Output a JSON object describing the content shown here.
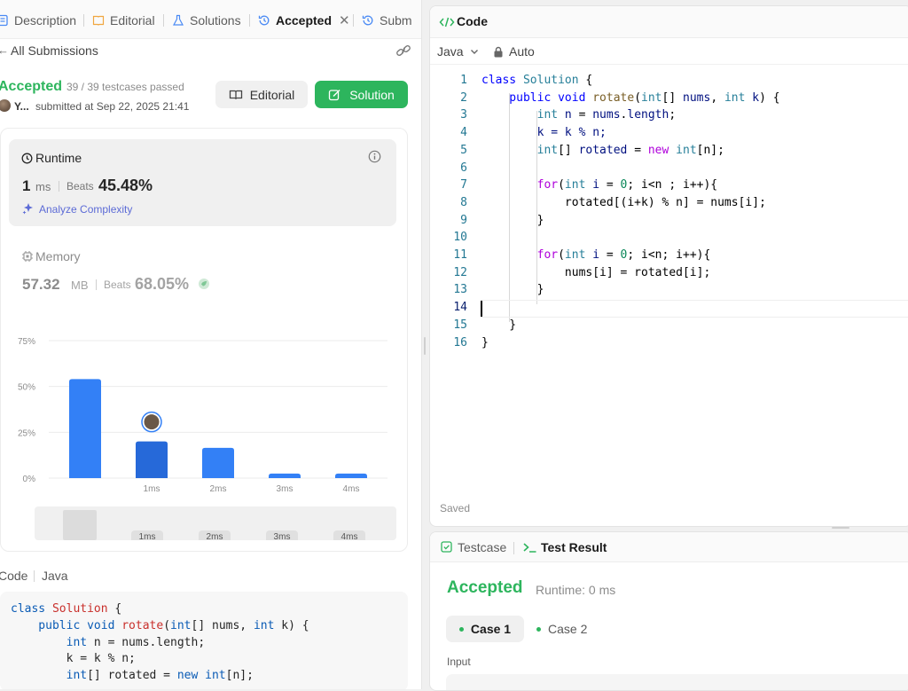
{
  "left_tabs": [
    {
      "label": "Description",
      "icon": "description-icon"
    },
    {
      "label": "Editorial",
      "icon": "book-icon"
    },
    {
      "label": "Solutions",
      "icon": "flask-icon"
    },
    {
      "label": "Accepted",
      "icon": "history-icon",
      "active": true
    },
    {
      "label": "Subm",
      "icon": "history-icon"
    }
  ],
  "submission": {
    "back_label": "All Submissions",
    "status": "Accepted",
    "testcases": "39 / 39 testcases passed",
    "user": "Y...",
    "submitted_at": "submitted at Sep 22, 2025 21:41",
    "editorial_button": "Editorial",
    "solution_button": "Solution"
  },
  "runtime": {
    "title": "Runtime",
    "value": "1",
    "unit": "ms",
    "beats_label": "Beats",
    "beats": "45.48%",
    "analyze_label": "Analyze Complexity"
  },
  "memory": {
    "title": "Memory",
    "value": "57.32",
    "unit": "MB",
    "beats_label": "Beats",
    "beats": "68.05%"
  },
  "chart_data": {
    "type": "bar",
    "categories": [
      "",
      "1ms",
      "2ms",
      "3ms",
      "4ms"
    ],
    "values": [
      54,
      20,
      16.5,
      2.5,
      2.5
    ],
    "highlight_index": 1,
    "yticks": [
      "0%",
      "25%",
      "50%",
      "75%"
    ],
    "ylim": [
      0,
      75
    ],
    "grid": true,
    "navigator_labels": [
      "1ms",
      "2ms",
      "3ms",
      "4ms"
    ],
    "colors": {
      "bar": "#3380f6",
      "highlight": "#2669d9",
      "grid": "#ebebeb"
    }
  },
  "code_section": {
    "label": "Code",
    "lang": "Java",
    "lines": [
      [
        [
          "class ",
          "kw2"
        ],
        [
          "Solution",
          "cls"
        ],
        [
          " {",
          "p"
        ]
      ],
      [
        [
          "    public ",
          "kw2"
        ],
        [
          "void ",
          "kw2"
        ],
        [
          "rotate",
          "fn2"
        ],
        [
          "(",
          "p"
        ],
        [
          "int",
          "kw2"
        ],
        [
          "[] nums, ",
          "p"
        ],
        [
          "int ",
          "kw2"
        ],
        [
          "k) {",
          "p"
        ]
      ],
      [
        [
          "        int ",
          "kw2"
        ],
        [
          "n = nums.length;",
          "p"
        ]
      ],
      [
        [
          "        k = k % n;",
          "p"
        ]
      ],
      [
        [
          "        int",
          "kw2"
        ],
        [
          "[] rotated = ",
          "p"
        ],
        [
          "new ",
          "kw2"
        ],
        [
          "int",
          "kw2"
        ],
        [
          "[n];",
          "p"
        ]
      ]
    ]
  },
  "editor": {
    "tab_label": "Code",
    "language": "Java",
    "mode": "Auto",
    "saved_label": "Saved",
    "line_numbers": [
      "1",
      "2",
      "3",
      "4",
      "5",
      "6",
      "7",
      "8",
      "9",
      "10",
      "11",
      "12",
      "13",
      "14",
      "15",
      "16"
    ],
    "current_line": 14,
    "lines": [
      [
        [
          "class ",
          "kw"
        ],
        [
          "Solution",
          "ty"
        ],
        [
          " {",
          ""
        ]
      ],
      [
        [
          "    public ",
          "kw"
        ],
        [
          "void ",
          "kw"
        ],
        [
          "rotate",
          "fn"
        ],
        [
          "(",
          ""
        ],
        [
          "int",
          "ty"
        ],
        [
          "[] ",
          ""
        ],
        [
          "nums",
          "vr"
        ],
        [
          ", ",
          ""
        ],
        [
          "int ",
          "ty"
        ],
        [
          "k",
          "vr"
        ],
        [
          ") {",
          ""
        ]
      ],
      [
        [
          "        int ",
          "ty"
        ],
        [
          "n",
          "vr"
        ],
        [
          " = ",
          ""
        ],
        [
          "nums",
          "vr"
        ],
        [
          ".",
          ""
        ],
        [
          "length",
          "vr"
        ],
        [
          ";",
          ""
        ]
      ],
      [
        [
          "        k = k % n;",
          "vr"
        ]
      ],
      [
        [
          "        int",
          "ty"
        ],
        [
          "[] ",
          ""
        ],
        [
          "rotated",
          "vr"
        ],
        [
          " = ",
          ""
        ],
        [
          "new ",
          "cf"
        ],
        [
          "int",
          "ty"
        ],
        [
          "[n];",
          ""
        ]
      ],
      [
        [
          "",
          ""
        ]
      ],
      [
        [
          "        for",
          "cf"
        ],
        [
          "(",
          ""
        ],
        [
          "int ",
          "ty"
        ],
        [
          "i",
          "vr"
        ],
        [
          " = ",
          ""
        ],
        [
          "0",
          "nm"
        ],
        [
          "; i<n ; i++){",
          ""
        ]
      ],
      [
        [
          "            rotated[(i+k) % n] = nums[i];",
          ""
        ]
      ],
      [
        [
          "        }",
          ""
        ]
      ],
      [
        [
          "",
          ""
        ]
      ],
      [
        [
          "        for",
          "cf"
        ],
        [
          "(",
          ""
        ],
        [
          "int ",
          "ty"
        ],
        [
          "i",
          "vr"
        ],
        [
          " = ",
          ""
        ],
        [
          "0",
          "nm"
        ],
        [
          "; i<n; i++){",
          ""
        ]
      ],
      [
        [
          "            nums[i] = rotated[i];",
          ""
        ]
      ],
      [
        [
          "        }",
          ""
        ]
      ],
      [
        [
          "",
          ""
        ]
      ],
      [
        [
          "    }",
          ""
        ]
      ],
      [
        [
          "}",
          ""
        ]
      ]
    ]
  },
  "result_panel": {
    "testcase_tab": "Testcase",
    "result_tab": "Test Result",
    "status": "Accepted",
    "runtime": "Runtime: 0 ms",
    "cases": [
      "Case 1",
      "Case 2"
    ],
    "input_label": "Input"
  }
}
